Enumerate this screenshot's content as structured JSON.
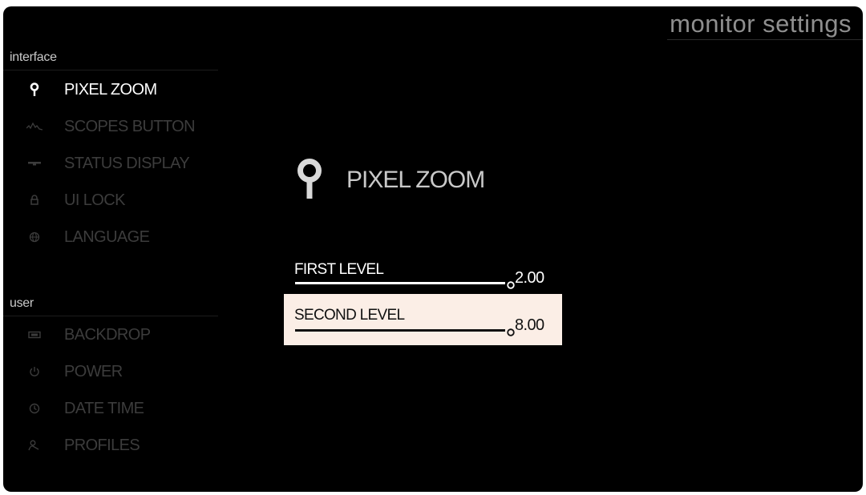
{
  "header": {
    "title": "monitor settings"
  },
  "sidebar": {
    "sections": [
      {
        "label": "interface",
        "items": [
          {
            "label": "PIXEL ZOOM",
            "icon": "pin-icon",
            "active": true
          },
          {
            "label": "SCOPES BUTTON",
            "icon": "waveform-icon",
            "active": false
          },
          {
            "label": "STATUS DISPLAY",
            "icon": "status-bar-icon",
            "active": false
          },
          {
            "label": "UI LOCK",
            "icon": "lock-icon",
            "active": false
          },
          {
            "label": "LANGUAGE",
            "icon": "globe-icon",
            "active": false
          }
        ]
      },
      {
        "label": "user",
        "items": [
          {
            "label": "BACKDROP",
            "icon": "backdrop-icon",
            "active": false
          },
          {
            "label": "POWER",
            "icon": "power-icon",
            "active": false
          },
          {
            "label": "DATE TIME",
            "icon": "clock-icon",
            "active": false
          },
          {
            "label": "PROFILES",
            "icon": "profile-icon",
            "active": false
          }
        ]
      }
    ]
  },
  "detail": {
    "icon": "pin-icon",
    "title": "PIXEL ZOOM",
    "settings": [
      {
        "label": "FIRST LEVEL",
        "value": "2.00",
        "selected": false
      },
      {
        "label": "SECOND LEVEL",
        "value": "8.00",
        "selected": true
      }
    ]
  },
  "colors": {
    "background": "#000000",
    "active_text": "#ffffff",
    "inactive_text": "#3c3c3c",
    "selected_row": "#fbeee6",
    "header_text": "#8f8f8f"
  }
}
